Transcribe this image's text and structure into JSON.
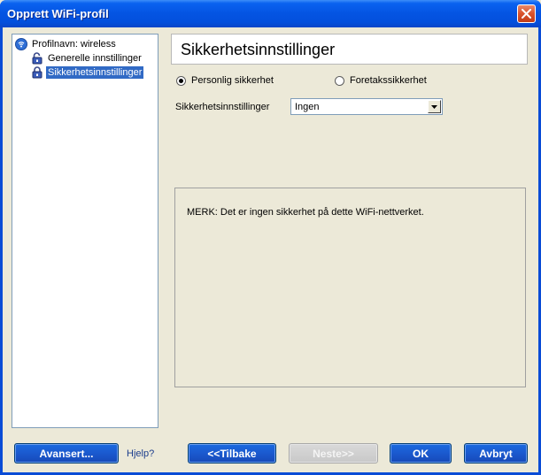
{
  "window": {
    "title": "Opprett WiFi-profil",
    "close_icon": "close-icon"
  },
  "tree": {
    "items": [
      {
        "label": "Profilnavn: wireless",
        "icon": "wifi-profile-icon",
        "selected": false
      },
      {
        "label": "Generelle innstillinger",
        "icon": "lock-open-icon",
        "selected": false
      },
      {
        "label": "Sikkerhetsinnstillinger",
        "icon": "lock-closed-icon",
        "selected": true
      }
    ]
  },
  "header": {
    "title": "Sikkerhetsinnstillinger"
  },
  "security_type": {
    "personal_label": "Personlig sikkerhet",
    "enterprise_label": "Foretakssikkerhet",
    "selected": "personal"
  },
  "security_settings": {
    "label": "Sikkerhetsinnstillinger",
    "value": "Ingen"
  },
  "note": {
    "text": "MERK: Det er ingen sikkerhet på dette WiFi-nettverket."
  },
  "buttons": {
    "advanced": "Avansert...",
    "help": "Hjelp?",
    "back": "<<Tilbake",
    "next": "Neste>>",
    "ok": "OK",
    "cancel": "Avbryt"
  },
  "colors": {
    "titlebar": "#0454e2",
    "button": "#1b5bd0",
    "selection": "#316ac5",
    "dialog_bg": "#ece9d8"
  }
}
